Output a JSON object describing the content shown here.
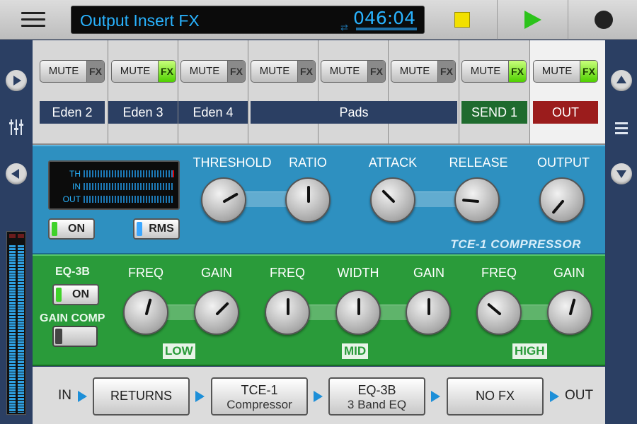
{
  "header": {
    "title": "Output Insert FX",
    "time": "046:04",
    "colors": {
      "display_text": "#29b3ff",
      "stop": "#f2e000",
      "play": "#2cc31b"
    }
  },
  "channels": [
    {
      "name": "Eden 2",
      "mute": "MUTE",
      "fx": "FX",
      "fx_on": false
    },
    {
      "name": "Eden 3",
      "mute": "MUTE",
      "fx": "FX",
      "fx_on": true
    },
    {
      "name": "Eden 4",
      "mute": "MUTE",
      "fx": "FX",
      "fx_on": false
    },
    {
      "name": "Pads",
      "mute": "MUTE",
      "fx": "FX",
      "fx_on": false
    },
    {
      "name": "",
      "mute": "MUTE",
      "fx": "FX",
      "fx_on": false
    },
    {
      "name": "",
      "mute": "MUTE",
      "fx": "FX",
      "fx_on": false
    },
    {
      "name": "SEND 1",
      "mute": "MUTE",
      "fx": "FX",
      "fx_on": true
    },
    {
      "name": "OUT",
      "mute": "MUTE",
      "fx": "FX",
      "fx_on": true
    }
  ],
  "compressor": {
    "name": "TCE-1 COMPRESSOR",
    "meter_labels": [
      "TH",
      "IN",
      "OUT"
    ],
    "on_label": "ON",
    "rms_label": "RMS",
    "knobs": [
      {
        "label": "THRESHOLD",
        "angle": 60
      },
      {
        "label": "RATIO",
        "angle": 0
      },
      {
        "label": "ATTACK",
        "angle": -45
      },
      {
        "label": "RELEASE",
        "angle": -85
      },
      {
        "label": "OUTPUT",
        "angle": 220
      }
    ]
  },
  "eq": {
    "name": "EQ-3B",
    "on_label": "ON",
    "gain_comp_label": "GAIN COMP",
    "knobs": [
      {
        "label": "FREQ",
        "angle": 15
      },
      {
        "label": "GAIN",
        "angle": 45
      },
      {
        "label": "FREQ",
        "angle": 0
      },
      {
        "label": "WIDTH",
        "angle": 0
      },
      {
        "label": "GAIN",
        "angle": 0
      },
      {
        "label": "FREQ",
        "angle": -50
      },
      {
        "label": "GAIN",
        "angle": 15
      }
    ],
    "bands": [
      "LOW",
      "MID",
      "HIGH"
    ]
  },
  "chain": {
    "in_label": "IN",
    "out_label": "OUT",
    "slots": [
      {
        "line1": "RETURNS",
        "line2": ""
      },
      {
        "line1": "TCE-1",
        "line2": "Compressor"
      },
      {
        "line1": "EQ-3B",
        "line2": "3 Band EQ"
      },
      {
        "line1": "NO FX",
        "line2": ""
      }
    ]
  }
}
